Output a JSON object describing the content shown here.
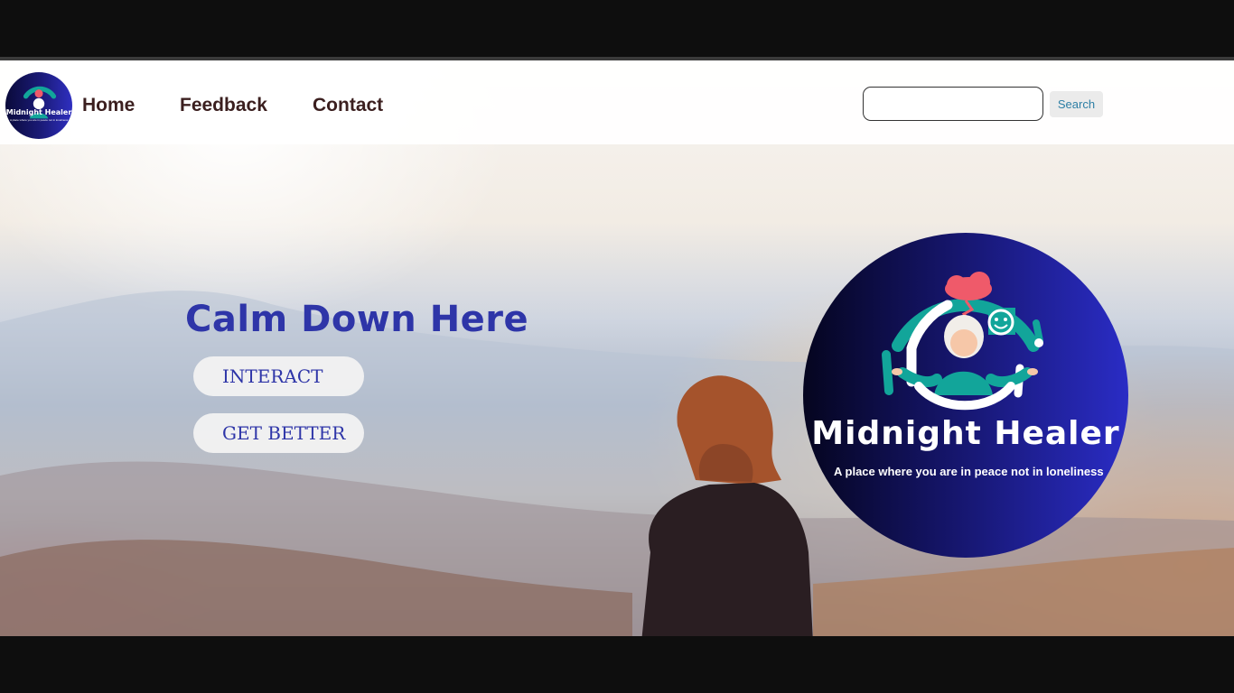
{
  "nav": {
    "logo": {
      "title": "Midnight Healer",
      "tagline": "A place where you are in peace not in loneliness"
    },
    "links": [
      {
        "label": "Home"
      },
      {
        "label": "Feedback"
      },
      {
        "label": "Contact"
      }
    ],
    "search": {
      "value": "",
      "placeholder": "",
      "button_label": "Search"
    }
  },
  "hero": {
    "title": "Calm Down Here",
    "buttons": [
      {
        "label": "INTERACT"
      },
      {
        "label": "GET BETTER"
      }
    ],
    "logo": {
      "title": "Midnight Healer",
      "tagline": "A place where you are in peace not in loneliness"
    },
    "image": "woman-overlooking-mountains-at-sunrise"
  },
  "colors": {
    "nav_link": "#3b1f1f",
    "hero_title": "#2e35a8",
    "logo_dark": "#05051f",
    "logo_light": "#2a2cc5",
    "logo_teal": "#12a59a",
    "search_button_text": "#2d7fa5"
  }
}
